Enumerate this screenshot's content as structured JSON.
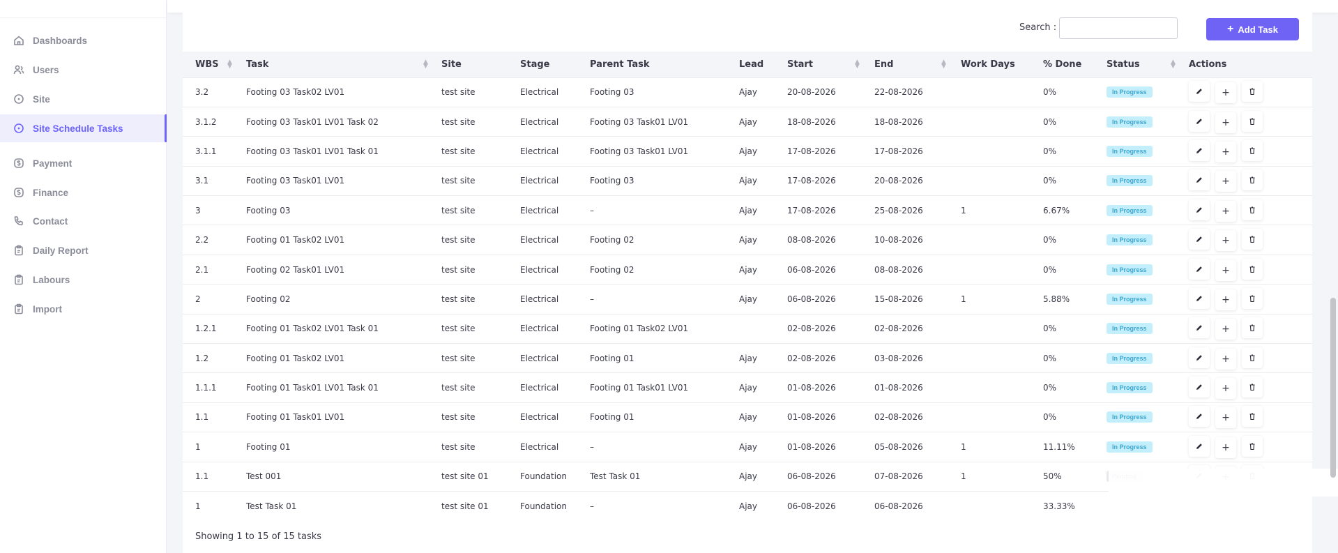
{
  "sidebar": {
    "items": [
      {
        "label": "Dashboards",
        "icon": "home-icon"
      },
      {
        "label": "Users",
        "icon": "users-icon"
      },
      {
        "label": "Site",
        "icon": "circle-icon"
      },
      {
        "label": "Site Schedule Tasks",
        "icon": "circle-icon",
        "active": true
      },
      {
        "label": "Payment",
        "icon": "dollar-icon"
      },
      {
        "label": "Finance",
        "icon": "dollar-icon"
      },
      {
        "label": "Contact",
        "icon": "phone-icon"
      },
      {
        "label": "Daily Report",
        "icon": "clipboard-icon"
      },
      {
        "label": "Labours",
        "icon": "clipboard-icon"
      },
      {
        "label": "Import",
        "icon": "clipboard-icon"
      }
    ]
  },
  "toolbar": {
    "search_label": "Search :",
    "search_value": "",
    "add_task_label": "Add Task"
  },
  "table": {
    "headers": {
      "wbs": "WBS",
      "task": "Task",
      "site": "Site",
      "stage": "Stage",
      "parent": "Parent Task",
      "lead": "Lead",
      "start": "Start",
      "end": "End",
      "workdays": "Work Days",
      "done": "% Done",
      "status": "Status",
      "actions": "Actions"
    },
    "rows": [
      {
        "wbs": "3.2",
        "task": "Footing 03 Task02 LV01",
        "site": "test site",
        "stage": "Electrical",
        "parent": "Footing 03",
        "lead": "Ajay",
        "start": "20-08-2026",
        "end": "22-08-2026",
        "workdays": "",
        "done": "0%",
        "status": "In Progress"
      },
      {
        "wbs": "3.1.2",
        "task": "Footing 03 Task01 LV01 Task 02",
        "site": "test site",
        "stage": "Electrical",
        "parent": "Footing 03 Task01 LV01",
        "lead": "Ajay",
        "start": "18-08-2026",
        "end": "18-08-2026",
        "workdays": "",
        "done": "0%",
        "status": "In Progress"
      },
      {
        "wbs": "3.1.1",
        "task": "Footing 03 Task01 LV01 Task 01",
        "site": "test site",
        "stage": "Electrical",
        "parent": "Footing 03 Task01 LV01",
        "lead": "Ajay",
        "start": "17-08-2026",
        "end": "17-08-2026",
        "workdays": "",
        "done": "0%",
        "status": "In Progress"
      },
      {
        "wbs": "3.1",
        "task": "Footing 03 Task01 LV01",
        "site": "test site",
        "stage": "Electrical",
        "parent": "Footing 03",
        "lead": "Ajay",
        "start": "17-08-2026",
        "end": "20-08-2026",
        "workdays": "",
        "done": "0%",
        "status": "In Progress"
      },
      {
        "wbs": "3",
        "task": "Footing 03",
        "site": "test site",
        "stage": "Electrical",
        "parent": "–",
        "lead": "Ajay",
        "start": "17-08-2026",
        "end": "25-08-2026",
        "workdays": "1",
        "done": "6.67%",
        "status": "In Progress"
      },
      {
        "wbs": "2.2",
        "task": "Footing 01 Task02 LV01",
        "site": "test site",
        "stage": "Electrical",
        "parent": "Footing 02",
        "lead": "Ajay",
        "start": "08-08-2026",
        "end": "10-08-2026",
        "workdays": "",
        "done": "0%",
        "status": "In Progress"
      },
      {
        "wbs": "2.1",
        "task": "Footing 02 Task01 LV01",
        "site": "test site",
        "stage": "Electrical",
        "parent": "Footing 02",
        "lead": "Ajay",
        "start": "06-08-2026",
        "end": "08-08-2026",
        "workdays": "",
        "done": "0%",
        "status": "In Progress"
      },
      {
        "wbs": "2",
        "task": "Footing 02",
        "site": "test site",
        "stage": "Electrical",
        "parent": "–",
        "lead": "Ajay",
        "start": "06-08-2026",
        "end": "15-08-2026",
        "workdays": "1",
        "done": "5.88%",
        "status": "In Progress"
      },
      {
        "wbs": "1.2.1",
        "task": "Footing 01 Task02 LV01 Task 01",
        "site": "test site",
        "stage": "Electrical",
        "parent": "Footing 01 Task02 LV01",
        "lead": "",
        "start": "02-08-2026",
        "end": "02-08-2026",
        "workdays": "",
        "done": "0%",
        "status": "In Progress"
      },
      {
        "wbs": "1.2",
        "task": "Footing 01 Task02 LV01",
        "site": "test site",
        "stage": "Electrical",
        "parent": "Footing 01",
        "lead": "Ajay",
        "start": "02-08-2026",
        "end": "03-08-2026",
        "workdays": "",
        "done": "0%",
        "status": "In Progress"
      },
      {
        "wbs": "1.1.1",
        "task": "Footing 01 Task01 LV01 Task 01",
        "site": "test site",
        "stage": "Electrical",
        "parent": "Footing 01 Task01 LV01",
        "lead": "Ajay",
        "start": "01-08-2026",
        "end": "01-08-2026",
        "workdays": "",
        "done": "0%",
        "status": "In Progress"
      },
      {
        "wbs": "1.1",
        "task": "Footing 01 Task01 LV01",
        "site": "test site",
        "stage": "Electrical",
        "parent": "Footing 01",
        "lead": "Ajay",
        "start": "01-08-2026",
        "end": "02-08-2026",
        "workdays": "",
        "done": "0%",
        "status": "In Progress"
      },
      {
        "wbs": "1",
        "task": "Footing 01",
        "site": "test site",
        "stage": "Electrical",
        "parent": "–",
        "lead": "Ajay",
        "start": "01-08-2026",
        "end": "05-08-2026",
        "workdays": "1",
        "done": "11.11%",
        "status": "In Progress"
      },
      {
        "wbs": "1.1",
        "task": "Test 001",
        "site": "test site 01",
        "stage": "Foundation",
        "parent": "Test Task 01",
        "lead": "Ajay",
        "start": "06-08-2026",
        "end": "07-08-2026",
        "workdays": "1",
        "done": "50%",
        "status": "Pending"
      },
      {
        "wbs": "1",
        "task": "Test Task 01",
        "site": "test site 01",
        "stage": "Foundation",
        "parent": "–",
        "lead": "Ajay",
        "start": "06-08-2026",
        "end": "06-08-2026",
        "workdays": "",
        "done": "33.33%",
        "status": ""
      }
    ]
  },
  "footer": {
    "summary": "Showing 1 to 15 of 15 tasks"
  },
  "colors": {
    "accent": "#6f63f6",
    "badge_bg": "#c3eefc",
    "badge_text": "#3ea6cf"
  }
}
